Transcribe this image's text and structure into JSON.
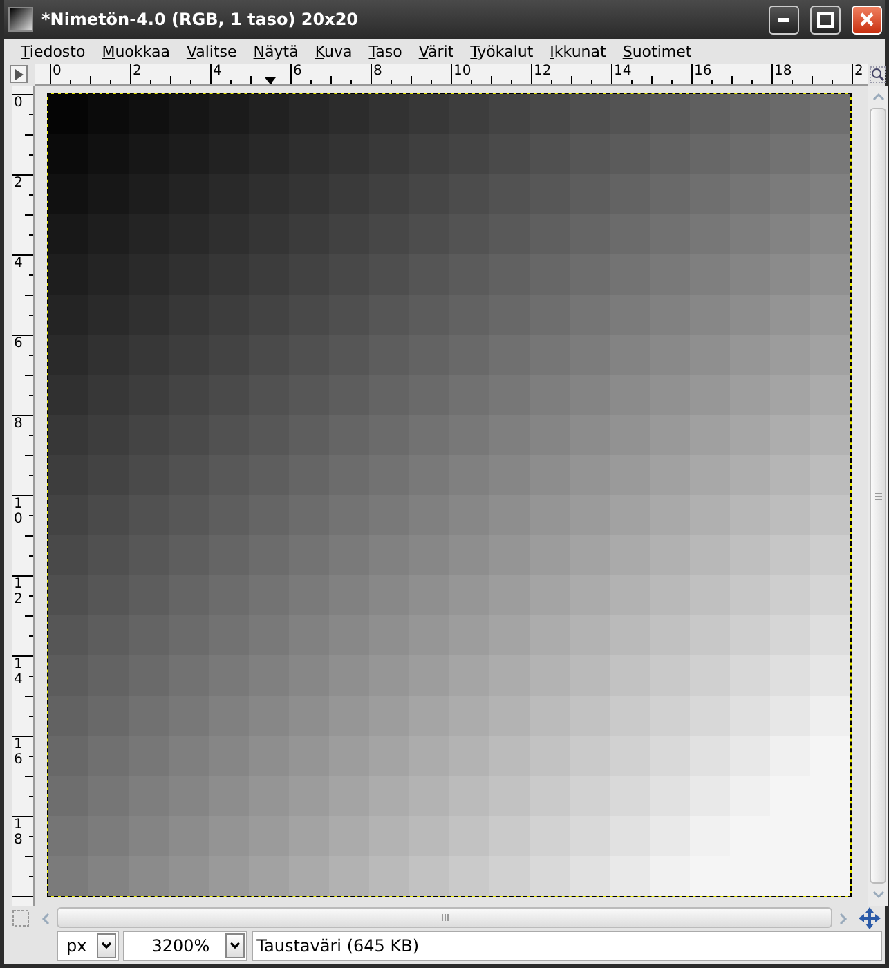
{
  "window": {
    "title": "*Nimetön-4.0 (RGB, 1 taso) 20x20"
  },
  "menu": [
    "Tiedosto",
    "Muokkaa",
    "Valitse",
    "Näytä",
    "Kuva",
    "Taso",
    "Värit",
    "Työkalut",
    "Ikkunat",
    "Suotimet"
  ],
  "horizontal_ruler": {
    "labels": [
      "0",
      "2",
      "4",
      "6",
      "8",
      "10",
      "12",
      "14",
      "16",
      "18",
      "2"
    ]
  },
  "vertical_ruler": {
    "labels": [
      "0",
      "2",
      "4",
      "6",
      "8",
      "10",
      "12",
      "14",
      "16",
      "18"
    ]
  },
  "status_bar": {
    "unit": "px",
    "zoom": "3200%",
    "message": "Taustaväri (645 KB)"
  }
}
